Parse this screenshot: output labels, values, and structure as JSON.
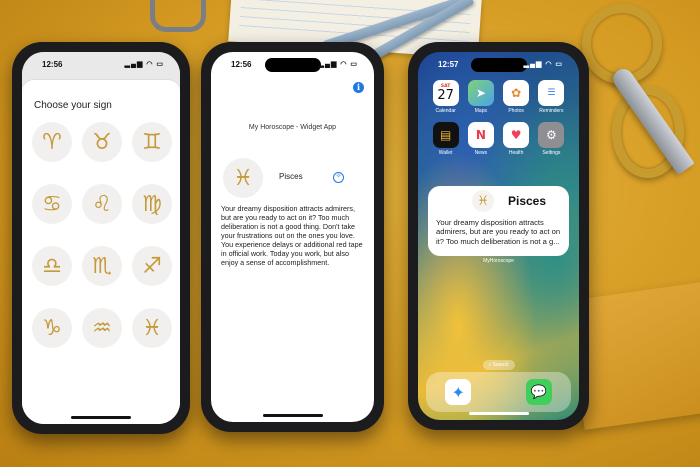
{
  "phone1": {
    "status_time": "12:56",
    "title": "Choose your sign",
    "signs": [
      {
        "name": "aries",
        "glyph": "♈"
      },
      {
        "name": "taurus",
        "glyph": "♉"
      },
      {
        "name": "gemini",
        "glyph": "♊"
      },
      {
        "name": "cancer",
        "glyph": "♋"
      },
      {
        "name": "leo",
        "glyph": "♌"
      },
      {
        "name": "virgo",
        "glyph": "♍"
      },
      {
        "name": "libra",
        "glyph": "♎"
      },
      {
        "name": "scorpio",
        "glyph": "♏"
      },
      {
        "name": "sagittarius",
        "glyph": "♐"
      },
      {
        "name": "capricorn",
        "glyph": "♑"
      },
      {
        "name": "aquarius",
        "glyph": "♒"
      },
      {
        "name": "pisces",
        "glyph": "♓"
      }
    ]
  },
  "phone2": {
    "status_time": "12:56",
    "app_title": "My Horoscope - Widget App",
    "sign_name": "Pisces",
    "sign_glyph": "♓",
    "horoscope": "Your dreamy disposition attracts admirers, but are you ready to act on it? Too much deliberation is not a good thing. Don't take your frustrations out on the ones you love. You experience delays or additional red tape in official work. Today you work, but also enjoy a sense of accomplishment."
  },
  "phone3": {
    "status_time": "12:57",
    "calendar": {
      "day": "SAT",
      "date": "27"
    },
    "apps": [
      "Calendar",
      "Maps",
      "Photos",
      "Reminders",
      "Wallet",
      "News",
      "Health",
      "Settings"
    ],
    "widget": {
      "sign_name": "Pisces",
      "sign_glyph": "♓",
      "text": "Your dreamy disposition attracts admirers, but are you ready to act on it? Too much deliberation is not a g...",
      "caption": "MyHoroscope"
    },
    "search_label": "Search"
  }
}
